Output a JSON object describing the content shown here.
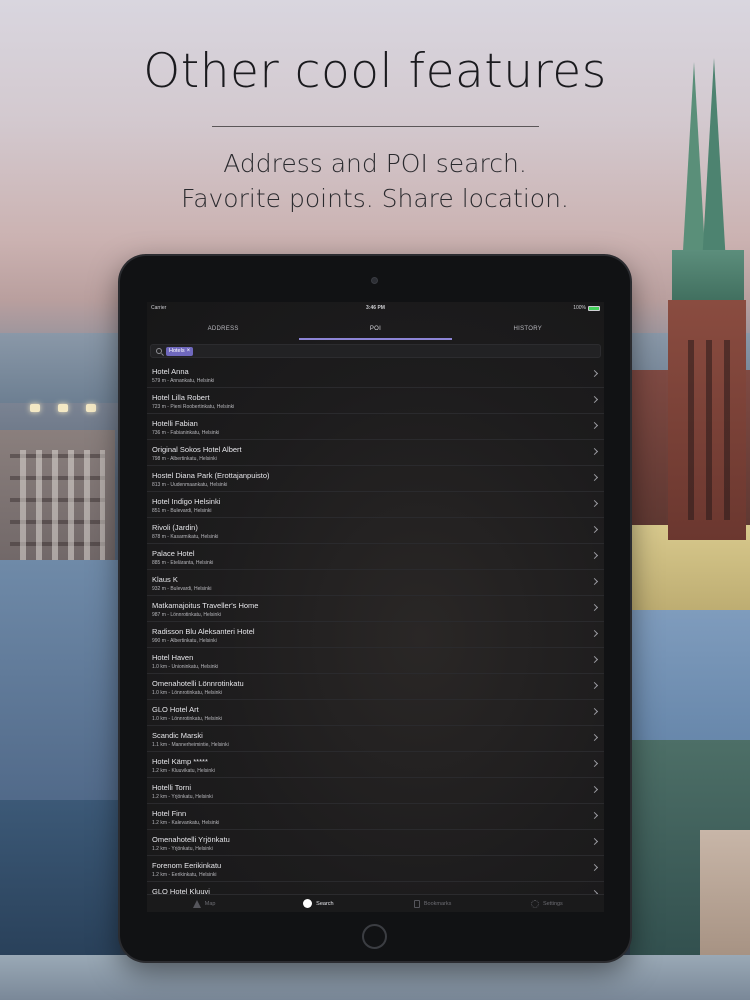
{
  "header": {
    "title": "Other cool features",
    "subtitle_line1": "Address and POI search.",
    "subtitle_line2": "Favorite points. Share location."
  },
  "status_bar": {
    "carrier": "Carrier",
    "time": "3:46 PM",
    "battery": "100%",
    "battery_level": 1.0
  },
  "tabs": [
    {
      "label": "ADDRESS",
      "active": false
    },
    {
      "label": "POI",
      "active": true
    },
    {
      "label": "HISTORY",
      "active": false
    }
  ],
  "search": {
    "chip_label": "Hotels",
    "chip_remove": "×"
  },
  "results": [
    {
      "name": "Hotel Anna",
      "detail": "579 m - Annankatu, Helsinki"
    },
    {
      "name": "Hotel Lilla Robert",
      "detail": "723 m - Pieni Roobertinkatu, Helsinki"
    },
    {
      "name": "Hotelli Fabian",
      "detail": "736 m - Fabianinkatu, Helsinki"
    },
    {
      "name": "Original Sokos Hotel Albert",
      "detail": "798 m - Albertinkatu, Helsinki"
    },
    {
      "name": "Hostel Diana Park (Erottajanpuisto)",
      "detail": "813 m - Uudenmaankatu, Helsinki"
    },
    {
      "name": "Hotel Indigo Helsinki",
      "detail": "851 m - Bulevardi, Helsinki"
    },
    {
      "name": "Rivoli (Jardin)",
      "detail": "878 m - Kasarmikatu, Helsinki"
    },
    {
      "name": "Palace Hotel",
      "detail": "885 m - Eteläranta, Helsinki"
    },
    {
      "name": "Klaus K",
      "detail": "932 m - Bulevardi, Helsinki"
    },
    {
      "name": "Matkamajoitus Traveller's Home",
      "detail": "987 m - Lönnrotinkatu, Helsinki"
    },
    {
      "name": "Radisson Blu Aleksanteri Hotel",
      "detail": "990 m - Albertinkatu, Helsinki"
    },
    {
      "name": "Hotel Haven",
      "detail": "1.0 km - Unioninkatu, Helsinki"
    },
    {
      "name": "Omenahotelli Lönnrotinkatu",
      "detail": "1.0 km - Lönnrotinkatu, Helsinki"
    },
    {
      "name": "GLO Hotel Art",
      "detail": "1.0 km - Lönnrotinkatu, Helsinki"
    },
    {
      "name": "Scandic Marski",
      "detail": "1.1 km - Mannerheimintie, Helsinki"
    },
    {
      "name": "Hotel Kämp *****",
      "detail": "1.2 km - Kluuvikatu, Helsinki"
    },
    {
      "name": "Hotelli Torni",
      "detail": "1.2 km - Yrjönkatu, Helsinki"
    },
    {
      "name": "Hotel Finn",
      "detail": "1.2 km - Kalevankatu, Helsinki"
    },
    {
      "name": "Omenahotelli Yrjönkatu",
      "detail": "1.2 km - Yrjönkatu, Helsinki"
    },
    {
      "name": "Forenom Eerikinkatu",
      "detail": "1.2 km - Eerikinkatu, Helsinki"
    },
    {
      "name": "GLO Hotel Kluuvi",
      "detail": ""
    }
  ],
  "tabbar": [
    {
      "label": "Map",
      "icon": "map-icon",
      "active": false
    },
    {
      "label": "Search",
      "icon": "search-icon",
      "active": true
    },
    {
      "label": "Bookmarks",
      "icon": "bookmark-icon",
      "active": false
    },
    {
      "label": "Settings",
      "icon": "gear-icon",
      "active": false
    }
  ],
  "colors": {
    "accent": "#8d85d6",
    "chip": "#6f68bd",
    "battery": "#44d15c"
  }
}
